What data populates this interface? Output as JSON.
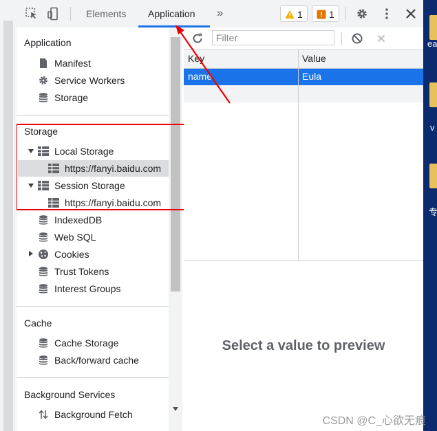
{
  "toolbar": {
    "tabs": [
      "Elements",
      "Application"
    ],
    "more_tabs": "»",
    "warnings_count": "1",
    "issues_count": "1"
  },
  "sidebar": {
    "application_title": "Application",
    "application_items": [
      "Manifest",
      "Service Workers",
      "Storage"
    ],
    "storage_title": "Storage",
    "local_storage": "Local Storage",
    "local_storage_origin": "https://fanyi.baidu.com",
    "session_storage": "Session Storage",
    "session_storage_origin": "https://fanyi.baidu.com",
    "storage_items": [
      "IndexedDB",
      "Web SQL",
      "Cookies",
      "Trust Tokens",
      "Interest Groups"
    ],
    "cache_title": "Cache",
    "cache_items": [
      "Cache Storage",
      "Back/forward cache"
    ],
    "background_title": "Background Services",
    "background_items": [
      "Background Fetch"
    ]
  },
  "main": {
    "filter_placeholder": "Filter",
    "columns": [
      "Key",
      "Value"
    ],
    "rows": [
      {
        "key": "name",
        "value": "Eula"
      }
    ],
    "preview_message": "Select a value to preview"
  },
  "desktop": {
    "labels": [
      "eac",
      "v",
      "专"
    ]
  },
  "watermark": "CSDN @C_心欲无痕",
  "colors": {
    "accent": "#1a73e8",
    "annotation": "#ee0000",
    "warning": "#f9ab00",
    "issue": "#e37400"
  }
}
